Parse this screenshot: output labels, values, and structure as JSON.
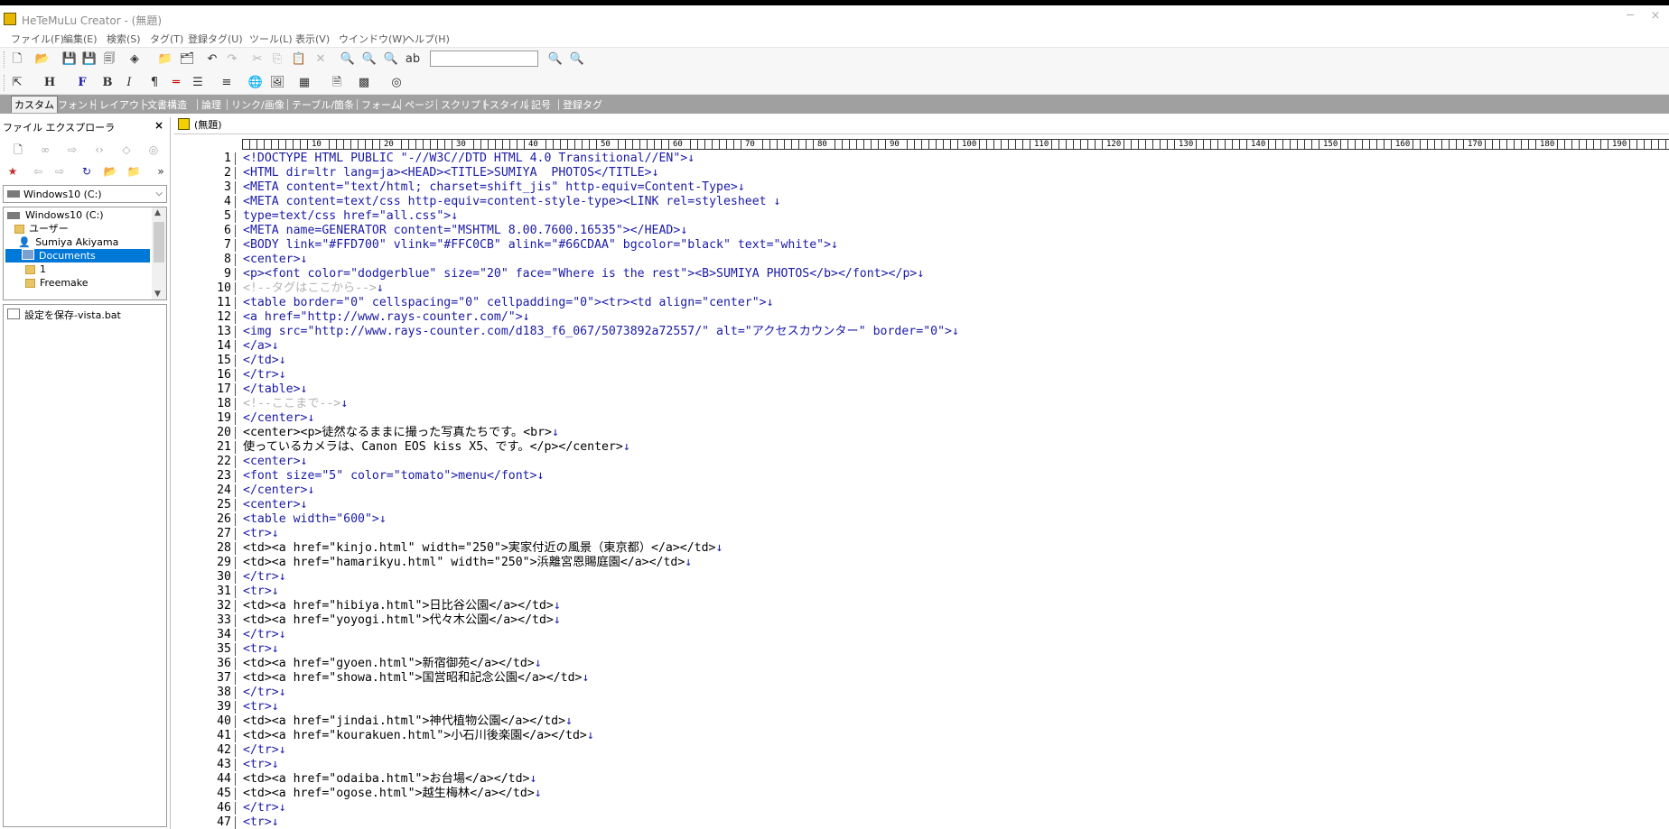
{
  "app": {
    "title": "HeTeMuLu Creator - (無題)",
    "minimize_glyph": "─",
    "close_glyph": "×"
  },
  "menu": [
    "ファイル(F)",
    "編集(E)",
    "検索(S)",
    "タグ(T)",
    "登録タグ(U)",
    "ツール(L)",
    "表示(V)",
    "ウインドウ(W)",
    "ヘルプ(H)"
  ],
  "toolbar1": {
    "icons": [
      "new-file-icon",
      "open-folder-icon",
      "save-icon",
      "save-as-icon",
      "save-all-icon",
      "publish-icon",
      "open-project-icon",
      "open-recent-icon",
      "undo-icon",
      "redo-icon",
      "cut-icon",
      "copy-icon",
      "paste-icon",
      "delete-icon",
      "find-icon",
      "find-next-icon",
      "find-prev-icon",
      "replace-icon",
      "quick-find-next-icon",
      "quick-find-prev-icon"
    ],
    "search_value": ""
  },
  "toolbar2": {
    "icons": [
      "insert-tag-icon",
      "heading-icon",
      "font-icon",
      "bold-icon",
      "italic-icon",
      "paragraph-icon",
      "hr-icon",
      "list-icon",
      "align-icon",
      "link-icon",
      "image-icon",
      "table-icon",
      "form-icon",
      "layout-icon",
      "preview-icon"
    ]
  },
  "tag_tabs": [
    "カスタム",
    "フォント",
    "レイアウト",
    "文書構造",
    "論理",
    "リンク/画像",
    "テーブル/箇条",
    "フォーム",
    "ページ",
    "スクリプト",
    "スタイル",
    "記号",
    "登録タグ"
  ],
  "explorer": {
    "title": "ファイル エクスプローラ",
    "close": "×",
    "drive": "Windows10 (C:)",
    "tree": [
      {
        "label": "Windows10 (C:)",
        "kind": "drive"
      },
      {
        "label": "ユーザー",
        "kind": "folder"
      },
      {
        "label": "Sumiya Akiyama",
        "kind": "user"
      },
      {
        "label": "Documents",
        "kind": "folder",
        "selected": true
      },
      {
        "label": "1",
        "kind": "folder"
      },
      {
        "label": "Freemake",
        "kind": "folder"
      }
    ],
    "files": [
      "設定を保存-vista.bat"
    ]
  },
  "document": {
    "tab_label": "(無題)",
    "ruler_marks": [
      "10",
      "20",
      "30",
      "40",
      "50",
      "60",
      "70",
      "80",
      "90",
      "100",
      "110",
      "120",
      "130",
      "140",
      "150",
      "160",
      "170",
      "180",
      "190"
    ],
    "eol_mark": "↓",
    "lines": [
      {
        "n": "1",
        "t": "<!DOCTYPE HTML PUBLIC \"-//W3C//DTD HTML 4.0 Transitional//EN\">",
        "k": "tag"
      },
      {
        "n": "2",
        "t": "<HTML dir=ltr lang=ja><HEAD><TITLE>SUMIYA  PHOTOS</TITLE>",
        "k": "tag"
      },
      {
        "n": "3",
        "t": "<META content=\"text/html; charset=shift_jis\" http-equiv=Content-Type>",
        "k": "tag"
      },
      {
        "n": "4",
        "t": "<META content=text/css http-equiv=content-style-type><LINK rel=stylesheet ",
        "k": "tag"
      },
      {
        "n": "5",
        "t": "type=text/css href=\"all.css\">",
        "k": "tag"
      },
      {
        "n": "6",
        "t": "<META name=GENERATOR content=\"MSHTML 8.00.7600.16535\"></HEAD>",
        "k": "tag"
      },
      {
        "n": "7",
        "t": "<BODY link=\"#FFD700\" vlink=\"#FFC0CB\" alink=\"#66CDAA\" bgcolor=\"black\" text=\"white\">",
        "k": "tag"
      },
      {
        "n": "8",
        "t": "<center>",
        "k": "tag"
      },
      {
        "n": "9",
        "t": "<p><font color=\"dodgerblue\" size=\"20\" face=\"Where is the rest\"><B>SUMIYA PHOTOS</b></font></p>",
        "k": "tag"
      },
      {
        "n": "10",
        "t": "<!--タグはここから-->",
        "k": "comment"
      },
      {
        "n": "11",
        "t": "<table border=\"0\" cellspacing=\"0\" cellpadding=\"0\"><tr><td align=\"center\">",
        "k": "tag"
      },
      {
        "n": "12",
        "t": "<a href=\"http://www.rays-counter.com/\">",
        "k": "tag"
      },
      {
        "n": "13",
        "t": "<img src=\"http://www.rays-counter.com/d183_f6_067/5073892a72557/\" alt=\"アクセスカウンター\" border=\"0\">",
        "k": "tag"
      },
      {
        "n": "14",
        "t": "</a>",
        "k": "tag"
      },
      {
        "n": "15",
        "t": "</td>",
        "k": "tag"
      },
      {
        "n": "16",
        "t": "</tr>",
        "k": "tag"
      },
      {
        "n": "17",
        "t": "</table>",
        "k": "tag"
      },
      {
        "n": "18",
        "t": "<!--ここまで-->",
        "k": "comment"
      },
      {
        "n": "19",
        "t": "</center>",
        "k": "tag"
      },
      {
        "n": "20",
        "t": "<center><p>徒然なるままに撮った写真たちです。<br>",
        "k": "text"
      },
      {
        "n": "21",
        "t": "使っているカメラは、Canon EOS kiss X5、です。</p></center>",
        "k": "text"
      },
      {
        "n": "22",
        "t": "<center>",
        "k": "tag"
      },
      {
        "n": "23",
        "t": "<font size=\"5\" color=\"tomato\">menu</font>",
        "k": "tag"
      },
      {
        "n": "24",
        "t": "</center>",
        "k": "tag"
      },
      {
        "n": "25",
        "t": "<center>",
        "k": "tag"
      },
      {
        "n": "26",
        "t": "<table width=\"600\">",
        "k": "tag"
      },
      {
        "n": "27",
        "t": "<tr>",
        "k": "tag"
      },
      {
        "n": "28",
        "t": "<td><a href=\"kinjo.html\" width=\"250\">実家付近の風景（東京都）</a></td>",
        "k": "text"
      },
      {
        "n": "29",
        "t": "<td><a href=\"hamarikyu.html\" width=\"250\">浜離宮恩賜庭園</a></td>",
        "k": "text"
      },
      {
        "n": "30",
        "t": "</tr>",
        "k": "tag"
      },
      {
        "n": "31",
        "t": "<tr>",
        "k": "tag"
      },
      {
        "n": "32",
        "t": "<td><a href=\"hibiya.html\">日比谷公園</a></td>",
        "k": "text"
      },
      {
        "n": "33",
        "t": "<td><a href=\"yoyogi.html\">代々木公園</a></td>",
        "k": "text"
      },
      {
        "n": "34",
        "t": "</tr>",
        "k": "tag"
      },
      {
        "n": "35",
        "t": "<tr>",
        "k": "tag"
      },
      {
        "n": "36",
        "t": "<td><a href=\"gyoen.html\">新宿御苑</a></td>",
        "k": "text"
      },
      {
        "n": "37",
        "t": "<td><a href=\"showa.html\">国営昭和記念公園</a></td>",
        "k": "text"
      },
      {
        "n": "38",
        "t": "</tr>",
        "k": "tag"
      },
      {
        "n": "39",
        "t": "<tr>",
        "k": "tag"
      },
      {
        "n": "40",
        "t": "<td><a href=\"jindai.html\">神代植物公園</a></td>",
        "k": "text"
      },
      {
        "n": "41",
        "t": "<td><a href=\"kourakuen.html\">小石川後楽園</a></td>",
        "k": "text"
      },
      {
        "n": "42",
        "t": "</tr>",
        "k": "tag"
      },
      {
        "n": "43",
        "t": "<tr>",
        "k": "tag"
      },
      {
        "n": "44",
        "t": "<td><a href=\"odaiba.html\">お台場</a></td>",
        "k": "text"
      },
      {
        "n": "45",
        "t": "<td><a href=\"ogose.html\">越生梅林</a></td>",
        "k": "text"
      },
      {
        "n": "46",
        "t": "</tr>",
        "k": "tag"
      },
      {
        "n": "47",
        "t": "<tr>",
        "k": "tag"
      }
    ]
  },
  "colors": {
    "tag": "#1a1aa6",
    "comment": "#b4b4b4",
    "selection": "#0078d7",
    "tabbar": "#a0a0a0"
  }
}
